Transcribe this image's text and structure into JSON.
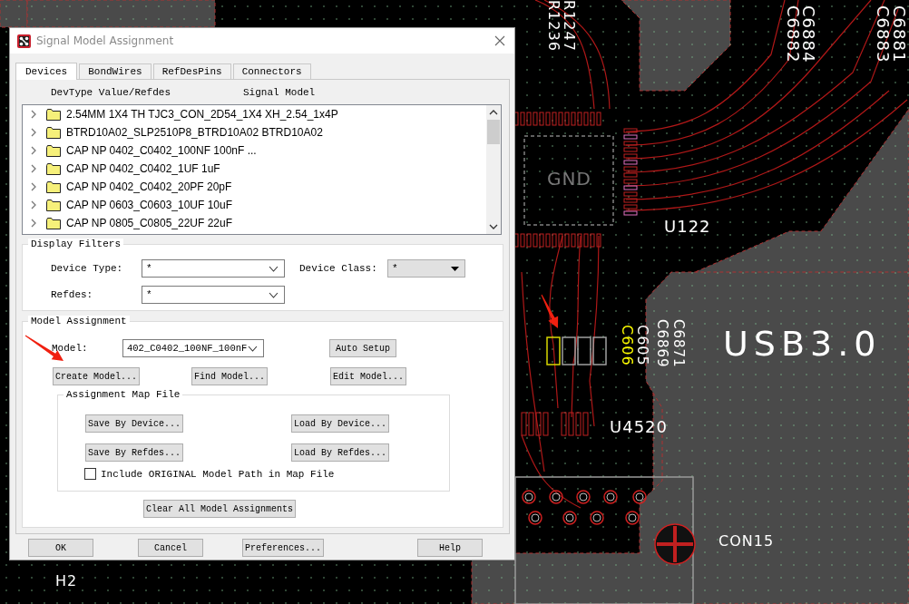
{
  "pcb": {
    "labels": [
      {
        "text": "R1247",
        "kind": "silk"
      },
      {
        "text": "R1236",
        "kind": "silk"
      },
      {
        "text": "C6884",
        "kind": "silk"
      },
      {
        "text": "C6882",
        "kind": "silk"
      },
      {
        "text": "C6883",
        "kind": "silk"
      },
      {
        "text": "C6881",
        "kind": "silk"
      },
      {
        "text": "GND",
        "kind": "net"
      },
      {
        "text": "U122",
        "kind": "silk"
      },
      {
        "text": "C606",
        "kind": "highlight"
      },
      {
        "text": "C605",
        "kind": "silk"
      },
      {
        "text": "C6869",
        "kind": "silk"
      },
      {
        "text": "C6871",
        "kind": "silk"
      },
      {
        "text": "USB3.0",
        "kind": "silk"
      },
      {
        "text": "U4520",
        "kind": "silk"
      },
      {
        "text": "CON15",
        "kind": "silk"
      },
      {
        "text": "H2",
        "kind": "silk"
      }
    ]
  },
  "dialog": {
    "title": "Signal Model Assignment",
    "tabs": [
      {
        "label": "Devices",
        "selected": true
      },
      {
        "label": "BondWires",
        "selected": false
      },
      {
        "label": "RefDesPins",
        "selected": false
      },
      {
        "label": "Connectors",
        "selected": false
      }
    ],
    "device_list": {
      "columns": [
        "DevType Value/Refdes",
        "Signal Model"
      ],
      "rows": [
        {
          "label": "2.54MM 1X4 TH TJC3_CON_2D54_1X4 XH_2.54_1x4P",
          "expanded": false
        },
        {
          "label": "BTRD10A02_SLP2510P8_BTRD10A02 BTRD10A02",
          "expanded": false
        },
        {
          "label": "CAP NP 0402_C0402_100NF 100nF ...",
          "expanded": false
        },
        {
          "label": "CAP NP 0402_C0402_1UF 1uF",
          "expanded": false
        },
        {
          "label": "CAP NP 0402_C0402_20PF 20pF",
          "expanded": false
        },
        {
          "label": "CAP NP 0603_C0603_10UF 10uF",
          "expanded": false
        },
        {
          "label": "CAP NP 0805_C0805_22UF 22uF",
          "expanded": false
        }
      ]
    },
    "display_filters": {
      "title": "Display Filters",
      "fields": [
        {
          "label": "Device Type:",
          "value": "*",
          "kind": "editable"
        },
        {
          "label": "Device Class:",
          "value": "*",
          "kind": "dropdown"
        },
        {
          "label": "Refdes:",
          "value": "*",
          "kind": "editable"
        }
      ]
    },
    "model_assignment": {
      "title": "Model Assignment",
      "model_label": "Model:",
      "model_value": "402_C0402_100NF_100nF",
      "buttons": [
        "Auto Setup",
        "Create Model...",
        "Find Model...",
        "Edit Model..."
      ]
    },
    "map_file": {
      "title": "Assignment Map File",
      "buttons": [
        "Save By Device...",
        "Load By Device...",
        "Save By Refdes...",
        "Load By Refdes..."
      ],
      "checkbox": {
        "label": "Include ORIGINAL Model Path in Map File",
        "checked": false
      }
    },
    "clear_button": "Clear All Model Assignments",
    "footer_buttons": [
      "OK",
      "Cancel",
      "Preferences...",
      "Help"
    ]
  }
}
